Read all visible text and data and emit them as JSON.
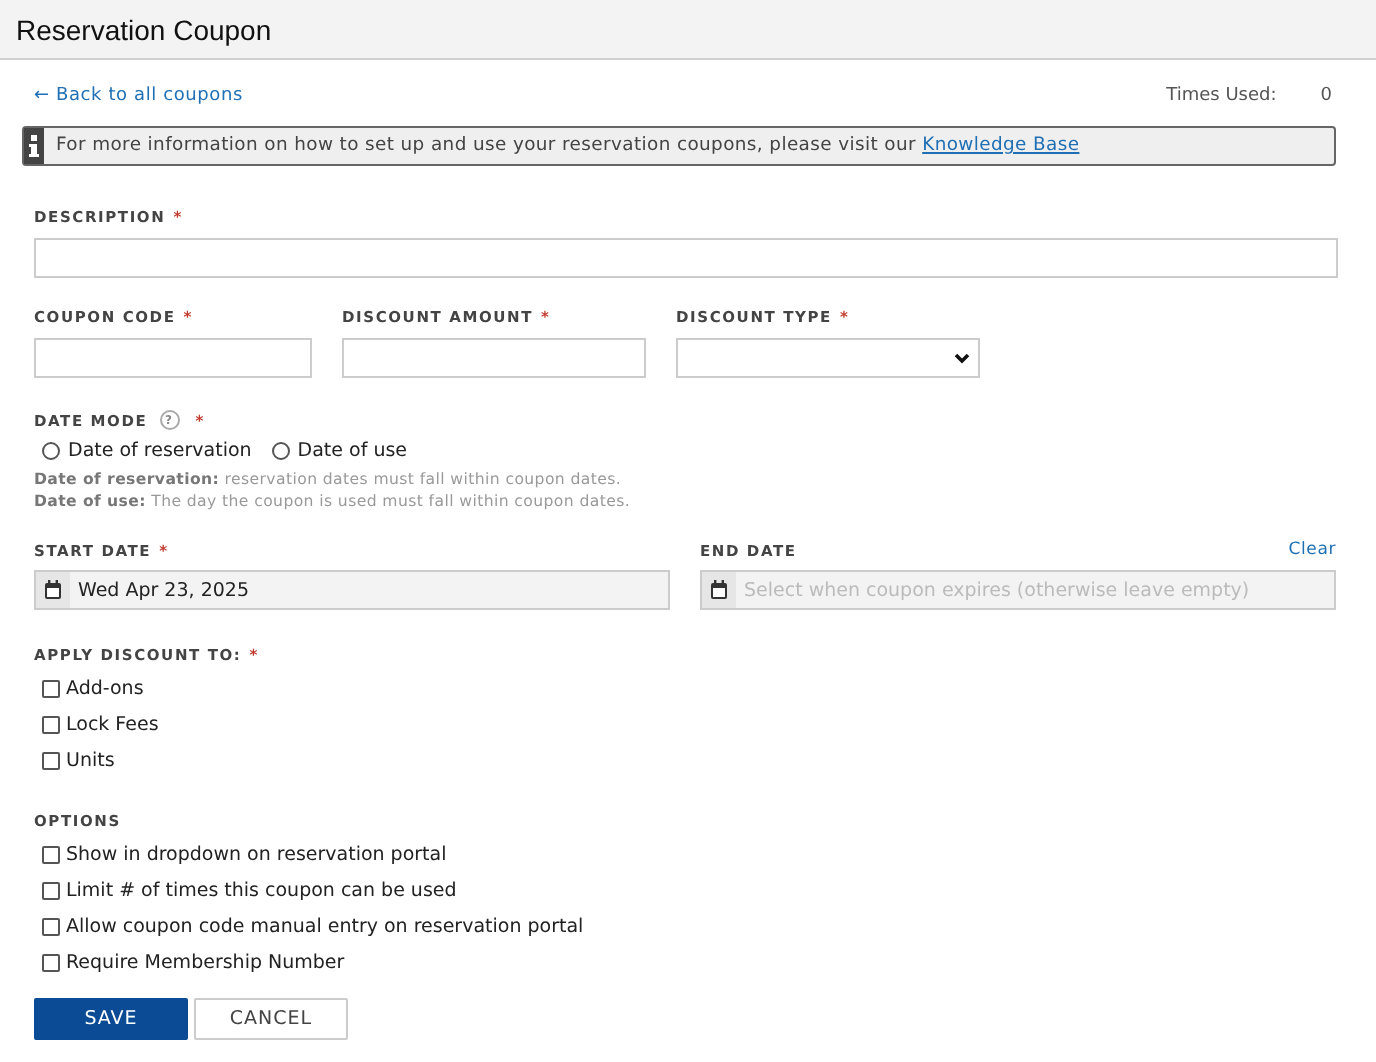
{
  "window": {
    "title": "Reservation Coupon"
  },
  "back_link": {
    "icon": "←",
    "label": "Back to all coupons"
  },
  "times_used": {
    "label": "Times Used:",
    "value": "0"
  },
  "info": {
    "text": "For more information on how to set up and use your reservation coupons, please visit our",
    "link": "Knowledge Base"
  },
  "description": {
    "label": "DESCRIPTION",
    "required_mark": "*"
  },
  "fields_row": [
    {
      "kind": "text",
      "label": "COUPON CODE",
      "required_mark": "*"
    },
    {
      "kind": "text",
      "label": "DISCOUNT AMOUNT",
      "required_mark": "*"
    },
    {
      "kind": "select",
      "label": "DISCOUNT TYPE",
      "required_mark": "*"
    }
  ],
  "date_mode": {
    "label": "DATE MODE",
    "help": "?",
    "required_mark": "*",
    "options": [
      {
        "label": "Date of reservation",
        "selected": false
      },
      {
        "label": "Date of use",
        "selected": false
      }
    ],
    "notes": [
      {
        "term": "Date of reservation:",
        "text": "reservation dates must fall within coupon dates."
      },
      {
        "term": "Date of use:",
        "text": "The day the coupon is used must fall within coupon dates."
      }
    ]
  },
  "start_date": {
    "label": "START DATE",
    "required_mark": "*",
    "value": "Wed Apr 23, 2025"
  },
  "end_date": {
    "label": "END DATE",
    "clear": "Clear",
    "placeholder": "Select when coupon expires (otherwise leave empty)"
  },
  "apply_to": {
    "label": "APPLY DISCOUNT TO:",
    "required_mark": "*",
    "items": [
      {
        "label": "Add-ons",
        "checked": false
      },
      {
        "label": "Lock Fees",
        "checked": false
      },
      {
        "label": "Units",
        "checked": false
      }
    ]
  },
  "options": {
    "label": "OPTIONS",
    "items": [
      {
        "label": "Show in dropdown on reservation portal",
        "checked": false
      },
      {
        "label": "Limit # of times this coupon can be used",
        "checked": false
      },
      {
        "label": "Allow coupon code manual entry on reservation portal",
        "checked": false
      },
      {
        "label": "Require Membership Number",
        "checked": false
      }
    ]
  },
  "buttons": [
    {
      "kind": "primary",
      "label": "SAVE"
    },
    {
      "kind": "secondary",
      "label": "CANCEL"
    }
  ]
}
